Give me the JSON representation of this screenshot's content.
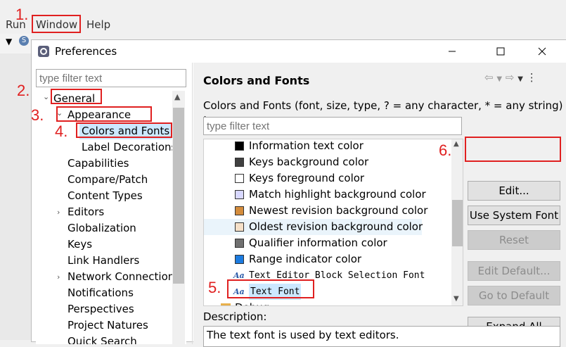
{
  "menubar": {
    "items": [
      "Run",
      "Window",
      "Help"
    ]
  },
  "dialog": {
    "title": "Preferences",
    "controls": {
      "minimize": "–",
      "maximize": "☐",
      "close": "✕"
    }
  },
  "left": {
    "filter_placeholder": "type filter text",
    "tree": [
      {
        "label": "General",
        "expanded": true
      },
      {
        "label": "Appearance",
        "expanded": true
      },
      {
        "label": "Colors and Fonts",
        "selected": true
      },
      {
        "label": "Label Decorations"
      },
      {
        "label": "Capabilities"
      },
      {
        "label": "Compare/Patch"
      },
      {
        "label": "Content Types"
      },
      {
        "label": "Editors",
        "expandable": true
      },
      {
        "label": "Globalization"
      },
      {
        "label": "Keys"
      },
      {
        "label": "Link Handlers"
      },
      {
        "label": "Network Connection",
        "expandable": true
      },
      {
        "label": "Notifications"
      },
      {
        "label": "Perspectives"
      },
      {
        "label": "Project Natures"
      },
      {
        "label": "Quick Search"
      }
    ]
  },
  "right": {
    "title": "Colors and Fonts",
    "description": "Colors and Fonts (font, size, type, ? = any character, * = any string) :",
    "filter_placeholder": "type filter text",
    "list": [
      {
        "label": "Information text color",
        "color": "#000000"
      },
      {
        "label": "Keys background color",
        "color": "#404040"
      },
      {
        "label": "Keys foreground color",
        "color": "#ffffff"
      },
      {
        "label": "Match highlight background color",
        "color": "#d8d8ff"
      },
      {
        "label": "Newest revision background color",
        "color": "#d48c3c"
      },
      {
        "label": "Oldest revision background color",
        "color": "#f5e0c8"
      },
      {
        "label": "Qualifier information color",
        "color": "#707070"
      },
      {
        "label": "Range indicator color",
        "color": "#1c7be0"
      },
      {
        "label": "Text Editor Block Selection Font",
        "font": true
      },
      {
        "label": "Text Font",
        "font": true,
        "selected": true
      },
      {
        "label": "Debug",
        "folder": true
      }
    ],
    "buttons": {
      "edit": "Edit...",
      "use_system_font": "Use System Font",
      "reset": "Reset",
      "edit_default": "Edit Default...",
      "go_to_default": "Go to Default",
      "expand_all": "Expand All"
    },
    "desc_label": "Description:",
    "desc_text": "The text font is used by text editors."
  },
  "annotations": [
    "1.",
    "2.",
    "3.",
    "4.",
    "5.",
    "6."
  ],
  "colors": {
    "annotation_red": "#e02020",
    "selection": "#cce8ff"
  }
}
